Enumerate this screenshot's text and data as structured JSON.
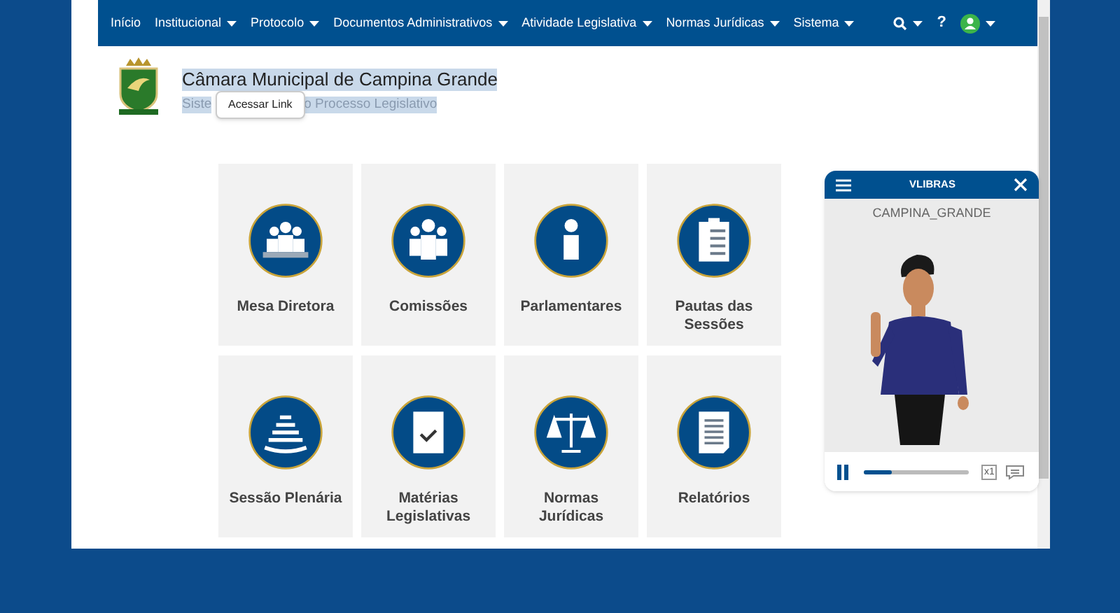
{
  "nav": {
    "items": [
      {
        "label": "Início",
        "dropdown": false
      },
      {
        "label": "Institucional",
        "dropdown": true
      },
      {
        "label": "Protocolo",
        "dropdown": true
      },
      {
        "label": "Documentos Administrativos",
        "dropdown": true
      },
      {
        "label": "Atividade Legislativa",
        "dropdown": true
      },
      {
        "label": "Normas Jurídicas",
        "dropdown": true
      },
      {
        "label": "Sistema",
        "dropdown": true
      }
    ],
    "help": "?"
  },
  "header": {
    "title": "Câmara Municipal de Campina Grande",
    "subtitle_start": "Siste",
    "subtitle_end": "o Processo Legislativo",
    "tooltip": "Acessar Link"
  },
  "tiles": [
    {
      "label": "Mesa Diretora",
      "kind": "board"
    },
    {
      "label": "Comissões",
      "kind": "group"
    },
    {
      "label": "Parlamentares",
      "kind": "person"
    },
    {
      "label": "Pautas das Sessões",
      "kind": "clipboard"
    },
    {
      "label": "Sessão Plenária",
      "kind": "plenary"
    },
    {
      "label": "Matérias Legislativas",
      "kind": "folder"
    },
    {
      "label": "Normas Jurídicas",
      "kind": "scales"
    },
    {
      "label": "Relatórios",
      "kind": "document"
    }
  ],
  "vlibras": {
    "title": "VLIBRAS",
    "caption": "CAMPINA_GRANDE",
    "progress": {
      "level": 0.27
    },
    "speed": "x1",
    "playing": true
  }
}
